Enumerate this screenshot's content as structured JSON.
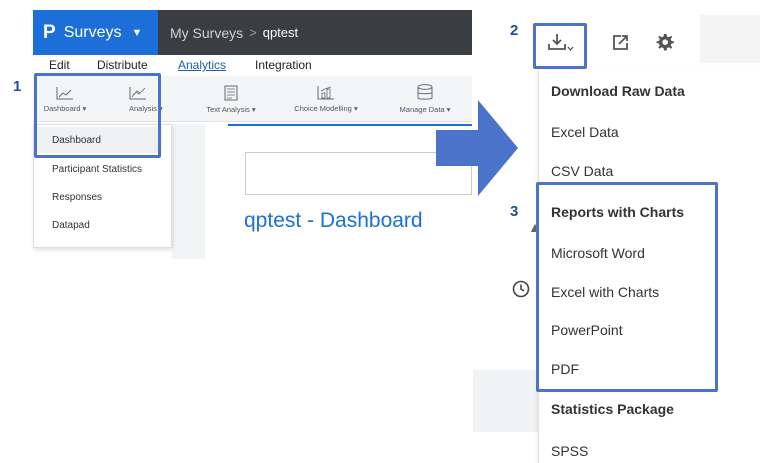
{
  "topbar": {
    "logo_glyph": "P",
    "app_name": "Surveys",
    "caret": "▼",
    "breadcrumb_root": "My Surveys",
    "breadcrumb_sep": ">",
    "breadcrumb_current": "qptest"
  },
  "subnav": {
    "edit": "Edit",
    "distribute": "Distribute",
    "analytics": "Analytics",
    "integration": "Integration"
  },
  "toolbar": {
    "dashboard": "Dashboard",
    "analysis": "Analysis",
    "text_analysis": "Text Analysis",
    "choice_modelling": "Choice Modelling",
    "manage_data": "Manage Data",
    "caret": "▾"
  },
  "dashboard_menu": {
    "items": [
      "Dashboard",
      "Participant Statistics",
      "Responses",
      "Datapad"
    ]
  },
  "page": {
    "title": "qptest - Dashboard"
  },
  "callouts": [
    "1",
    "2",
    "3"
  ],
  "download_menu": {
    "raw_header": "Download Raw Data",
    "excel_data": "Excel Data",
    "csv_data": "CSV Data",
    "reports_header": "Reports with Charts",
    "word": "Microsoft Word",
    "excel_charts": "Excel with Charts",
    "powerpoint": "PowerPoint",
    "pdf": "PDF",
    "stats_header": "Statistics Package",
    "spss": "SPSS"
  },
  "colors": {
    "brand": "#1c6fd8",
    "topbar": "#3a3d42",
    "highlight": "#4a73c9",
    "callout_number": "#1f4e9c"
  },
  "icons": [
    "download-icon",
    "share-icon",
    "gear-icon",
    "clock-icon",
    "line-chart-icon",
    "scatter-chart-icon",
    "document-icon",
    "bar-chart-icon",
    "database-icon"
  ]
}
